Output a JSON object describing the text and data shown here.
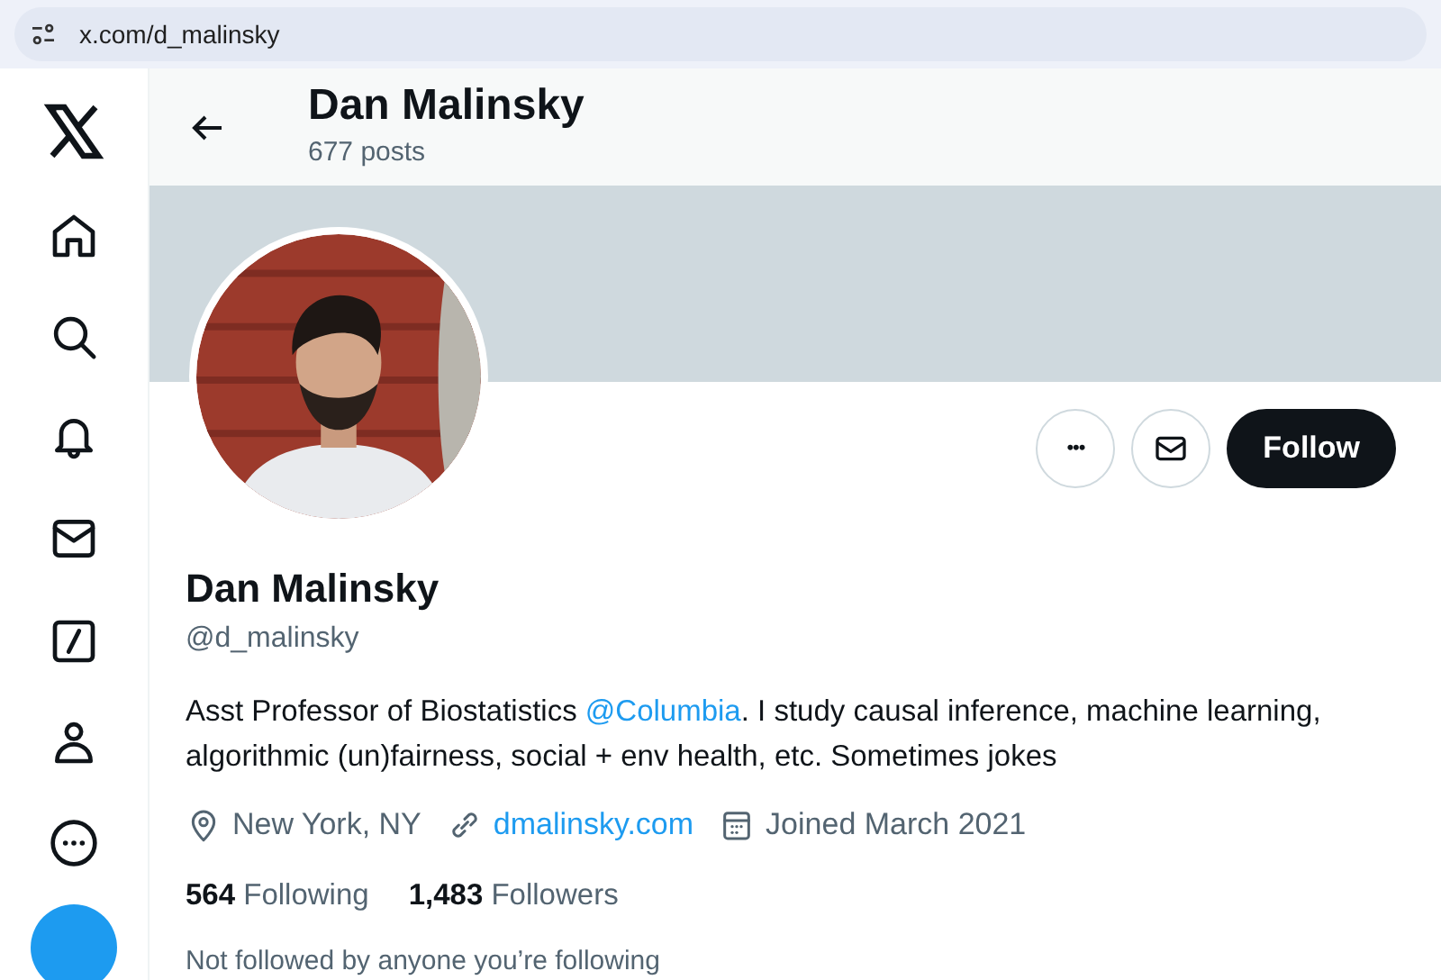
{
  "address_bar": {
    "url": "x.com/d_malinsky"
  },
  "sidebar": {
    "items": [
      {
        "kind": "logo"
      },
      {
        "kind": "home"
      },
      {
        "kind": "search"
      },
      {
        "kind": "bell"
      },
      {
        "kind": "mail"
      },
      {
        "kind": "slash"
      },
      {
        "kind": "person"
      },
      {
        "kind": "more"
      },
      {
        "kind": "post"
      }
    ]
  },
  "header": {
    "name": "Dan Malinsky",
    "posts": "677 posts"
  },
  "profile": {
    "actions": [
      {
        "kind": "more",
        "label": "•••"
      },
      {
        "kind": "message"
      },
      {
        "kind": "follow",
        "label": "Follow"
      }
    ],
    "name": "Dan Malinsky",
    "handle": "@d_malinsky",
    "bio": [
      {
        "kind": "text",
        "text": "Asst Professor of Biostatistics "
      },
      {
        "kind": "mention",
        "text": "@Columbia"
      },
      {
        "kind": "text",
        "text": ". I study causal inference, machine learning, algorithmic (un)fairness, social + env health, etc. Sometimes jokes"
      }
    ],
    "meta": [
      {
        "kind": "location",
        "text": "New York, NY"
      },
      {
        "kind": "link",
        "text": "dmalinsky.com"
      },
      {
        "kind": "joined",
        "text": "Joined March 2021"
      }
    ],
    "stats": [
      {
        "count": "564",
        "label": "Following"
      },
      {
        "count": "1,483",
        "label": "Followers"
      }
    ],
    "followed_by": "Not followed by anyone you’re following"
  }
}
